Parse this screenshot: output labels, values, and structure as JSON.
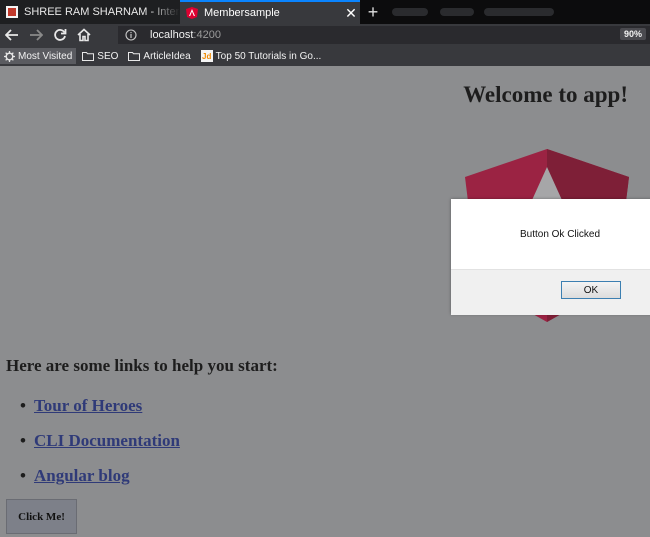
{
  "browser": {
    "tabs": [
      {
        "title": "SHREE RAM SHARNAM - Intern",
        "icon": "srs-favicon"
      },
      {
        "title": "Membersample",
        "icon": "angular-favicon",
        "active": true
      }
    ],
    "url": {
      "host": "localhost",
      "port": ":4200"
    },
    "zoom": "90%",
    "bookmarks": [
      {
        "label": "Most Visited",
        "icon": "gear-icon"
      },
      {
        "label": "SEO",
        "icon": "folder-icon"
      },
      {
        "label": "ArticleIdea",
        "icon": "folder-icon"
      },
      {
        "label": "Top 50 Tutorials in Go...",
        "icon": "jd-favicon"
      }
    ]
  },
  "page": {
    "welcome": "Welcome to app!",
    "links_title": "Here are some links to help you start:",
    "links": [
      "Tour of Heroes",
      "CLI Documentation",
      "Angular blog"
    ],
    "click_button": "Click Me!"
  },
  "dialog": {
    "message": "Button Ok Clicked",
    "ok_label": "OK"
  },
  "colors": {
    "angular_red": "#9b2343",
    "angular_red_dark": "#7e1f37",
    "link": "#2f3a78",
    "dim_overlay_bg": "#8c8d8f"
  }
}
